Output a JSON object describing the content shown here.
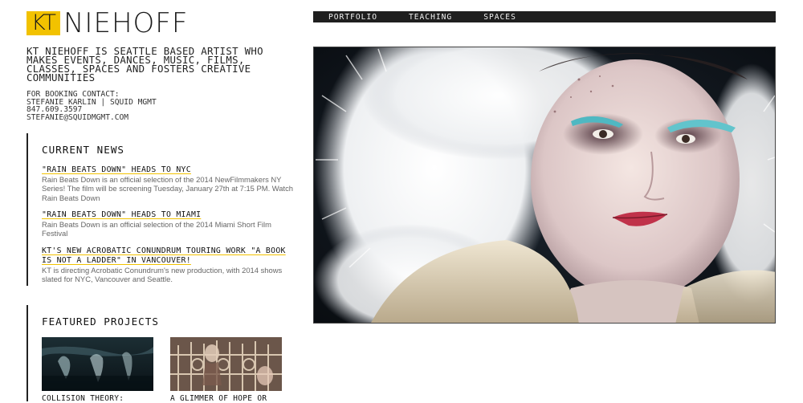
{
  "logo": {
    "mark": "KT",
    "name": "NIEHOFF"
  },
  "nav": {
    "items": [
      "PORTFOLIO",
      "TEACHING",
      "SPACES"
    ]
  },
  "intro": {
    "tagline": "KT NIEHOFF IS SEATTLE BASED ARTIST WHO MAKES EVENTS, DANCES, MUSIC, FILMS, CLASSES, SPACES AND FOSTERS CREATIVE COMMUNITIES",
    "booking": [
      "FOR BOOKING CONTACT:",
      "STEFANIE KARLIN | SQUID MGMT",
      "847.609.3597",
      "STEFANIE@SQUIDMGMT.COM"
    ]
  },
  "news": {
    "title": "CURRENT NEWS",
    "items": [
      {
        "headline": "\"RAIN BEATS DOWN\" HEADS TO NYC",
        "body": "Rain Beats Down is an official selection of the 2014 NewFilmmakers NY Series! The film will be screening Tuesday, January 27th at 7:15 PM. Watch Rain Beats Down"
      },
      {
        "headline": "\"RAIN BEATS DOWN\" HEADS TO MIAMI",
        "body": "Rain Beats Down is an official selection of the 2014 Miami Short Film Festival"
      },
      {
        "headline": "KT'S NEW ACROBATIC CONUNDRUM TOURING WORK \"A BOOK IS NOT A LADDER\" IN VANCOUVER!",
        "body": "KT is directing Acrobatic Conundrum's new production, with 2014 shows slated for NYC, Vancouver and Seattle."
      }
    ]
  },
  "featured": {
    "title": "FEATURED PROJECTS",
    "projects": [
      {
        "title": "COLLISION THEORY:"
      },
      {
        "title": "A GLIMMER OF HOPE OR"
      }
    ]
  },
  "colors": {
    "accent": "#f2c200",
    "nav_bg": "#1f1f1f",
    "text": "#222222",
    "body_text": "#666666"
  }
}
